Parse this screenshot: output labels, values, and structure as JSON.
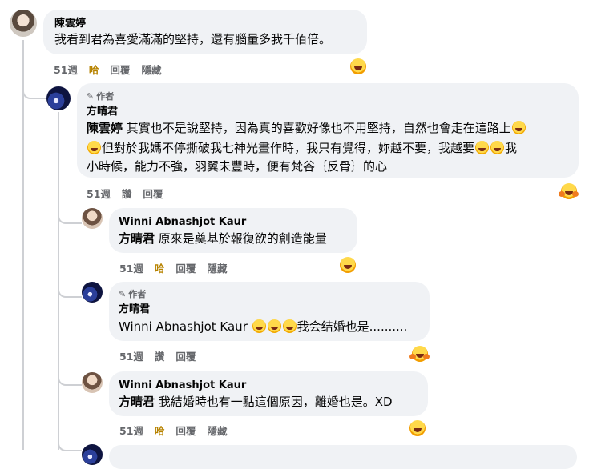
{
  "comments": [
    {
      "name": "陳雲婷",
      "text": "我看到君為喜愛滿滿的堅持，還有腦量多我千佰倍。",
      "time": "51週",
      "actions": [
        "哈",
        "回覆",
        "隱藏"
      ]
    },
    {
      "author_badge": "作者",
      "name": "方晴君",
      "mention": "陳雲婷",
      "line1": " 其實也不是說堅持，因為真的喜歡好像也不用堅持，自然也會走在這路上",
      "line2": "但對於我媽不停撕破我七神光畫作時，我只有覺得，妳越不要，我越要",
      "line2_end": "我",
      "line3": "小時候，能力不強，羽翼未豐時，便有梵谷｛反骨｝的心",
      "time": "51週",
      "actions": [
        "讚",
        "回覆"
      ]
    },
    {
      "name": "Winni Abnashjot Kaur",
      "mention": "方晴君",
      "text": " 原來是奠基於報復欲的創造能量",
      "time": "51週",
      "actions": [
        "哈",
        "回覆",
        "隱藏"
      ]
    },
    {
      "author_badge": "作者",
      "name": "方晴君",
      "mention": "Winni Abnashjot Kaur",
      "text": "我会结婚也是..........",
      "time": "51週",
      "actions": [
        "讚",
        "回覆"
      ]
    },
    {
      "name": "Winni Abnashjot Kaur",
      "mention": "方晴君",
      "text": " 我結婚時也有一點這個原因，離婚也是。XD",
      "time": "51週",
      "actions": [
        "哈",
        "回覆",
        "隱藏"
      ]
    }
  ],
  "icons": {
    "pencil": "pencil-icon",
    "laugh": "laughing-emoji",
    "care": "care-emoji"
  },
  "colors": {
    "bubble": "#f0f2f5",
    "meta": "#65676b",
    "haha": "#b78300",
    "thread": "#ced0d4"
  }
}
